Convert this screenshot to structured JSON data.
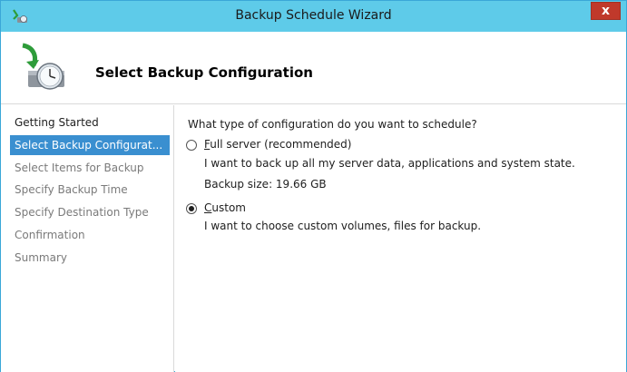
{
  "window": {
    "title": "Backup Schedule Wizard",
    "close_label": "x"
  },
  "header": {
    "title": "Select Backup Configuration"
  },
  "sidebar": {
    "items": [
      {
        "label": "Getting Started",
        "state": "done"
      },
      {
        "label": "Select Backup Configurat...",
        "state": "active"
      },
      {
        "label": "Select Items for Backup",
        "state": "pending"
      },
      {
        "label": "Specify Backup Time",
        "state": "pending"
      },
      {
        "label": "Specify Destination Type",
        "state": "pending"
      },
      {
        "label": "Confirmation",
        "state": "pending"
      },
      {
        "label": "Summary",
        "state": "pending"
      }
    ]
  },
  "main": {
    "question": "What type of configuration do you want to schedule?",
    "options": [
      {
        "accel": "F",
        "label_rest": "ull server (recommended)",
        "description": "I want to back up all my server data, applications and system state.",
        "extra": "Backup size: 19.66 GB",
        "selected": false
      },
      {
        "accel": "C",
        "label_rest": "ustom",
        "description": "I want to choose custom volumes, files for backup.",
        "selected": true
      }
    ]
  },
  "colors": {
    "titlebar": "#5ecbe9",
    "active_item": "#3a8fd0",
    "close_button": "#c0392b"
  }
}
